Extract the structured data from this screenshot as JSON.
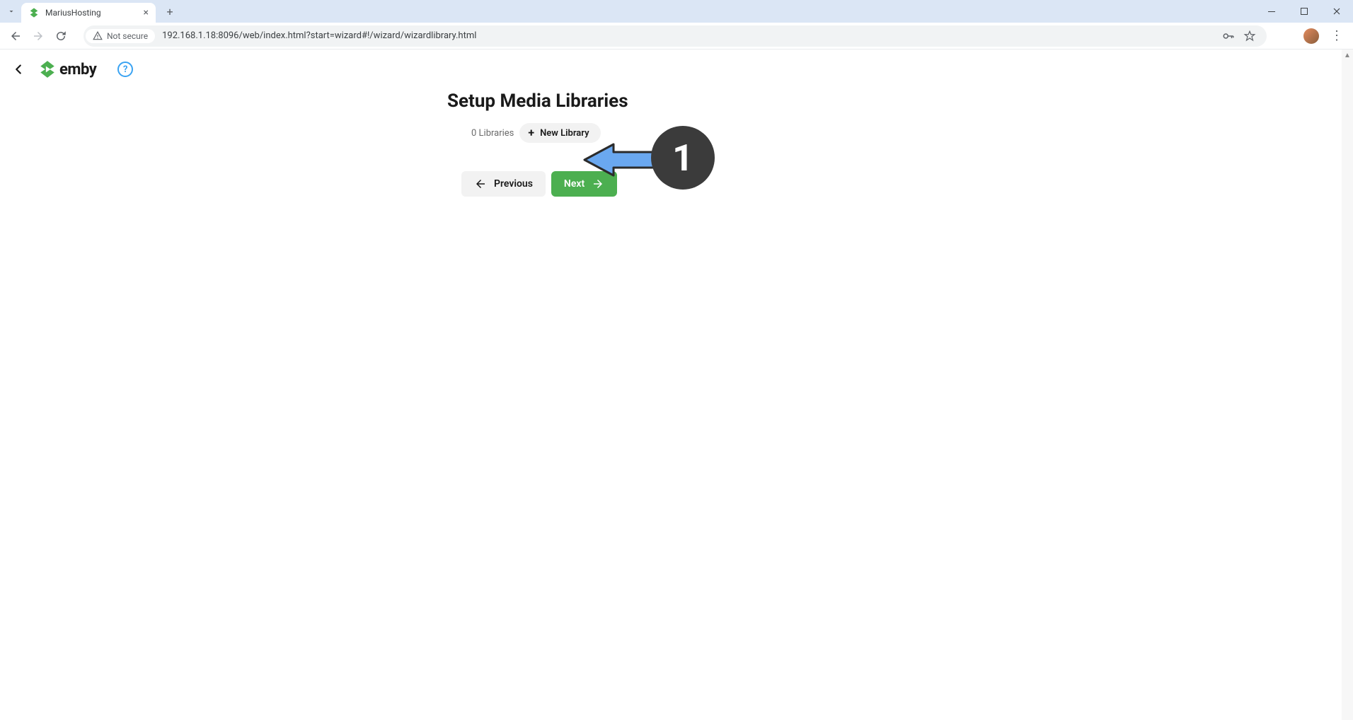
{
  "browser": {
    "tab_title": "MariusHosting",
    "not_secure_label": "Not secure",
    "url": "192.168.1.18:8096/web/index.html?start=wizard#!/wizard/wizardlibrary.html"
  },
  "app": {
    "logo_text": "emby",
    "page_title": "Setup Media Libraries",
    "library_count_label": "0 Libraries",
    "new_library_label": "New Library",
    "previous_label": "Previous",
    "next_label": "Next"
  },
  "annotation": {
    "badge_number": "1"
  },
  "colors": {
    "accent_green": "#4caf50",
    "arrow_blue": "#6aa8f0"
  }
}
